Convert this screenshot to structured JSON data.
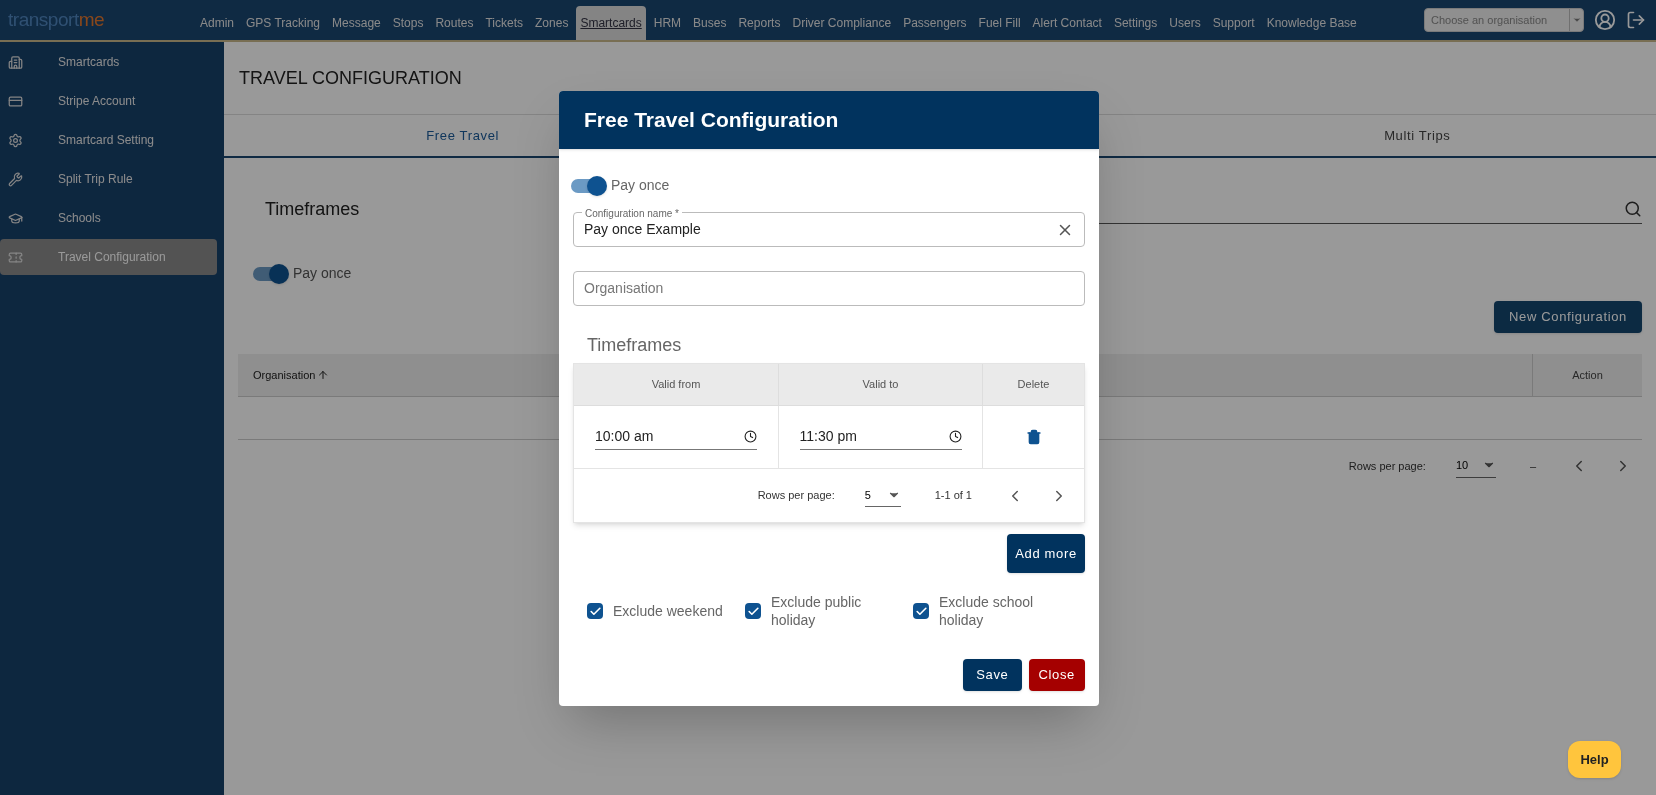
{
  "logo": {
    "main": "transport",
    "accent": "me"
  },
  "nav": [
    {
      "label": "Admin",
      "selected": false
    },
    {
      "label": "GPS Tracking",
      "selected": false
    },
    {
      "label": "Message",
      "selected": false
    },
    {
      "label": "Stops",
      "selected": false
    },
    {
      "label": "Routes",
      "selected": false
    },
    {
      "label": "Tickets",
      "selected": false
    },
    {
      "label": "Zones",
      "selected": false
    },
    {
      "label": "Smartcards",
      "selected": true
    },
    {
      "label": "HRM",
      "selected": false
    },
    {
      "label": "Buses",
      "selected": false
    },
    {
      "label": "Reports",
      "selected": false
    },
    {
      "label": "Driver Compliance",
      "selected": false
    },
    {
      "label": "Passengers",
      "selected": false
    },
    {
      "label": "Fuel Fill",
      "selected": false
    },
    {
      "label": "Alert Contact",
      "selected": false
    },
    {
      "label": "Settings",
      "selected": false
    },
    {
      "label": "Users",
      "selected": false
    },
    {
      "label": "Support",
      "selected": false
    },
    {
      "label": "Knowledge Base",
      "selected": false
    }
  ],
  "org_select": {
    "placeholder": "Choose an organisation"
  },
  "sidebar": {
    "items": [
      {
        "label": "Smartcards",
        "kind": "building",
        "selected": false
      },
      {
        "label": "Stripe Account",
        "kind": "card",
        "selected": false
      },
      {
        "label": "Smartcard Setting",
        "kind": "gear",
        "selected": false
      },
      {
        "label": "Split Trip Rule",
        "kind": "tools",
        "selected": false
      },
      {
        "label": "Schools",
        "kind": "school",
        "selected": false
      },
      {
        "label": "Travel Configuration",
        "kind": "ticket",
        "selected": true
      }
    ]
  },
  "page": {
    "title": "TRAVEL CONFIGURATION",
    "tabs": [
      {
        "label": "Free Travel",
        "selected": true
      },
      {
        "label": "Multi Trips",
        "selected": false
      }
    ],
    "heading": "Timeframes",
    "toggle": {
      "label": "Pay once",
      "on": true
    },
    "new_button": "New Configuration",
    "table": {
      "columns": [
        {
          "label": "Organisation",
          "sorted": true
        },
        {
          "label": "Action",
          "sorted": false
        }
      ]
    },
    "pagination": {
      "rows_label": "Rows per page:",
      "rows_value": "10",
      "range": "–"
    }
  },
  "modal": {
    "title": "Free Travel Configuration",
    "toggle": {
      "label": "Pay once",
      "on": true
    },
    "name_field": {
      "label": "Configuration name *",
      "value": "Pay once Example"
    },
    "org_field": {
      "placeholder": "Organisation"
    },
    "heading": "Timeframes",
    "table": {
      "columns": [
        "Valid from",
        "Valid to",
        "Delete"
      ],
      "rows": [
        {
          "from": "10:00 am",
          "to": "11:30 pm"
        }
      ],
      "pagination": {
        "rows_label": "Rows per page:",
        "rows_value": "5",
        "range": "1-1 of 1"
      }
    },
    "add_button": "Add more",
    "checkboxes": [
      {
        "label": "Exclude weekend",
        "checked": true
      },
      {
        "label": "Exclude public holiday",
        "checked": true
      },
      {
        "label": "Exclude school holiday",
        "checked": true
      }
    ],
    "buttons": [
      {
        "label": "Save",
        "kind": "primary"
      },
      {
        "label": "Close",
        "kind": "danger"
      }
    ]
  },
  "help": "Help"
}
